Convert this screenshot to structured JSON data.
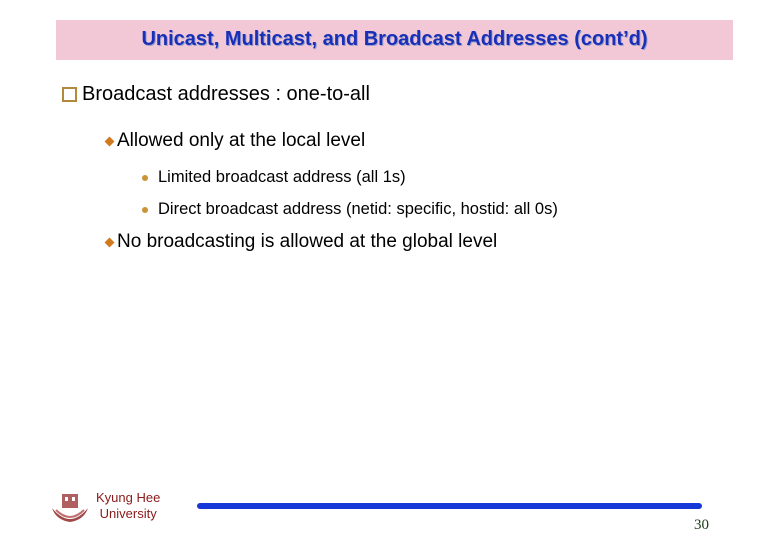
{
  "slide": {
    "title": "Unicast, Multicast, and Broadcast Addresses (cont’d)",
    "bullets": {
      "main": "Broadcast addresses : one-to-all",
      "sub1": "Allowed only at the local level",
      "sub1_items": [
        "Limited broadcast address (all 1s)",
        "Direct broadcast address (netid: specific, hostid: all 0s)"
      ],
      "sub2": "No broadcasting is allowed at the global level"
    },
    "footer": {
      "university_line1": "Kyung Hee",
      "university_line2": "University",
      "page_number": "30"
    },
    "colors": {
      "title_bg": "#f2c8d6",
      "title_text": "#1a2fb8",
      "footer_rule": "#1638d8",
      "university_text": "#8a1a1a"
    }
  }
}
